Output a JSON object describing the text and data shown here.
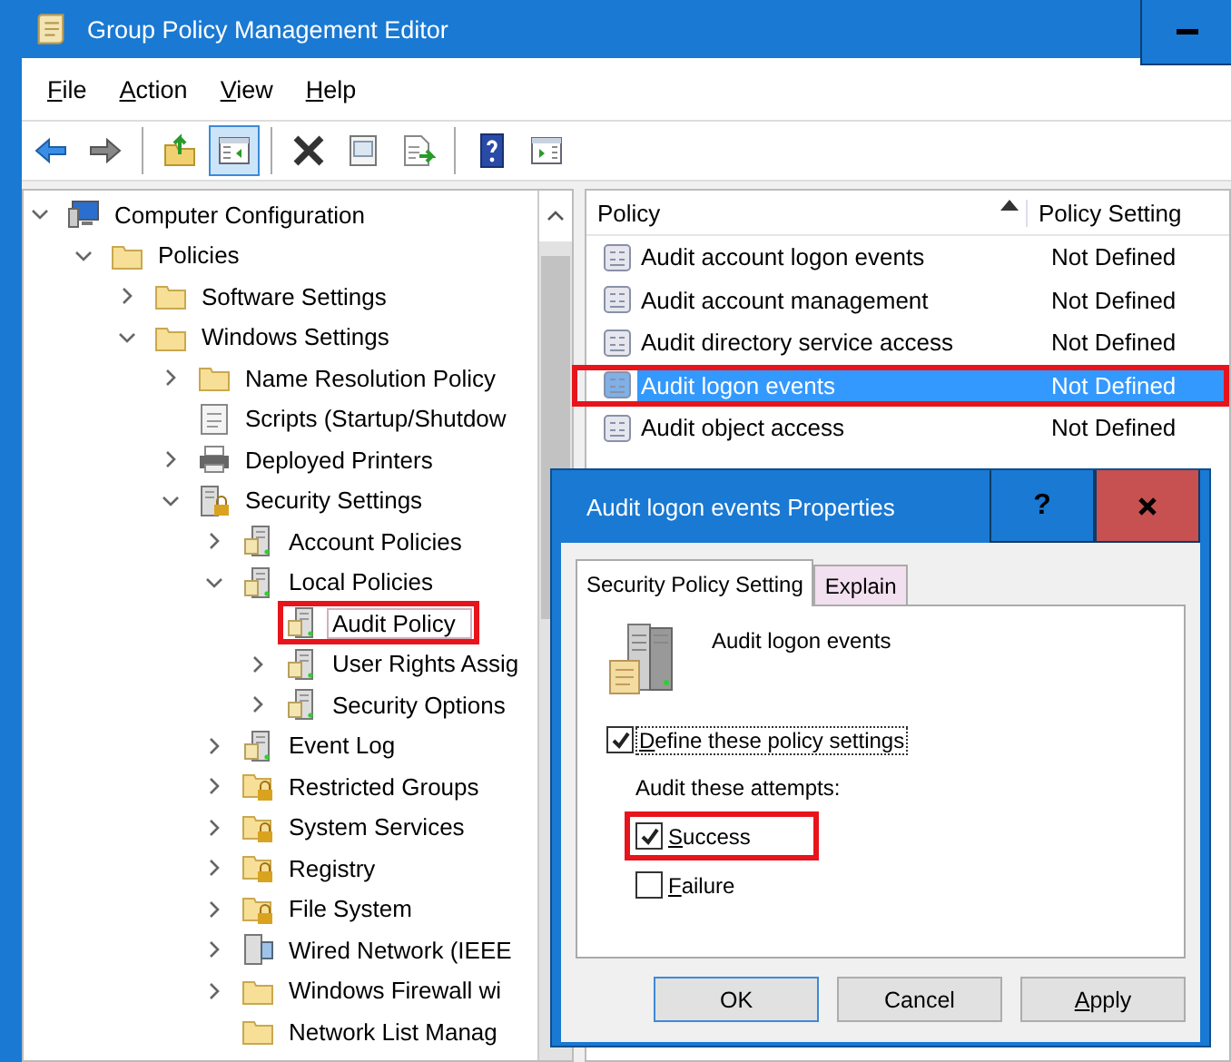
{
  "window": {
    "title": "Group Policy Management Editor"
  },
  "menu": [
    "File",
    "Action",
    "View",
    "Help"
  ],
  "toolbar": [
    {
      "kind": "back",
      "pressed": false
    },
    {
      "kind": "forward",
      "pressed": false
    },
    {
      "kind": "separator"
    },
    {
      "kind": "up-folder",
      "pressed": false
    },
    {
      "kind": "tree-pane",
      "pressed": true
    },
    {
      "kind": "separator"
    },
    {
      "kind": "delete",
      "pressed": false
    },
    {
      "kind": "properties",
      "pressed": false
    },
    {
      "kind": "export",
      "pressed": false
    },
    {
      "kind": "separator"
    },
    {
      "kind": "help",
      "pressed": false
    },
    {
      "kind": "action-pane",
      "pressed": false
    }
  ],
  "tree": [
    {
      "label": "Computer Configuration",
      "kind": "computer",
      "expanded": true,
      "selected": false,
      "highlighted": false,
      "children": [
        {
          "label": "Policies",
          "kind": "folder",
          "expanded": true,
          "selected": false,
          "highlighted": false,
          "children": [
            {
              "label": "Software Settings",
              "kind": "folder",
              "expanded": false,
              "selected": false,
              "highlighted": false
            },
            {
              "label": "Windows Settings",
              "kind": "folder",
              "expanded": true,
              "selected": false,
              "highlighted": false,
              "children": [
                {
                  "label": "Name Resolution Policy",
                  "kind": "folder",
                  "expanded": false,
                  "selected": false,
                  "highlighted": false
                },
                {
                  "label": "Scripts (Startup/Shutdow",
                  "kind": "script",
                  "selected": false,
                  "highlighted": false
                },
                {
                  "label": "Deployed Printers",
                  "kind": "printer",
                  "expanded": false,
                  "selected": false,
                  "highlighted": false
                },
                {
                  "label": "Security Settings",
                  "kind": "secure-server",
                  "expanded": true,
                  "selected": false,
                  "highlighted": false,
                  "children": [
                    {
                      "label": "Account Policies",
                      "kind": "server",
                      "expanded": false,
                      "selected": false,
                      "highlighted": false
                    },
                    {
                      "label": "Local Policies",
                      "kind": "server",
                      "expanded": true,
                      "selected": false,
                      "highlighted": false,
                      "children": [
                        {
                          "label": "Audit Policy",
                          "kind": "server",
                          "selected": true,
                          "highlighted": true
                        },
                        {
                          "label": "User Rights Assig",
                          "kind": "server",
                          "expanded": false,
                          "selected": false,
                          "highlighted": false
                        },
                        {
                          "label": "Security Options",
                          "kind": "server",
                          "expanded": false,
                          "selected": false,
                          "highlighted": false
                        }
                      ]
                    },
                    {
                      "label": "Event Log",
                      "kind": "server",
                      "expanded": false,
                      "selected": false,
                      "highlighted": false
                    },
                    {
                      "label": "Restricted Groups",
                      "kind": "secure-folder",
                      "expanded": false,
                      "selected": false,
                      "highlighted": false
                    },
                    {
                      "label": "System Services",
                      "kind": "secure-folder",
                      "expanded": false,
                      "selected": false,
                      "highlighted": false
                    },
                    {
                      "label": "Registry",
                      "kind": "secure-folder",
                      "expanded": false,
                      "selected": false,
                      "highlighted": false
                    },
                    {
                      "label": "File System",
                      "kind": "secure-folder",
                      "expanded": false,
                      "selected": false,
                      "highlighted": false
                    },
                    {
                      "label": "Wired Network (IEEE",
                      "kind": "network",
                      "expanded": false,
                      "selected": false,
                      "highlighted": false
                    },
                    {
                      "label": "Windows Firewall wi",
                      "kind": "folder",
                      "expanded": false,
                      "selected": false,
                      "highlighted": false
                    },
                    {
                      "label": "Network List Manag",
                      "kind": "folder",
                      "selected": false,
                      "highlighted": false
                    }
                  ]
                }
              ]
            }
          ]
        }
      ]
    }
  ],
  "table": {
    "columns": [
      "Policy",
      "Policy Setting"
    ],
    "rows": [
      {
        "policy": "Audit account logon events",
        "setting": "Not Defined",
        "selected": false,
        "highlighted": false
      },
      {
        "policy": "Audit account management",
        "setting": "Not Defined",
        "selected": false,
        "highlighted": false
      },
      {
        "policy": "Audit directory service access",
        "setting": "Not Defined",
        "selected": false,
        "highlighted": false
      },
      {
        "policy": "Audit logon events",
        "setting": "Not Defined",
        "selected": true,
        "highlighted": true
      },
      {
        "policy": "Audit object access",
        "setting": "Not Defined",
        "selected": false,
        "highlighted": false
      }
    ]
  },
  "dialog": {
    "title": "Audit logon events Properties",
    "help": "?",
    "tabs": [
      {
        "label": "Security Policy Setting",
        "selected": true
      },
      {
        "label": "Explain",
        "selected": false
      }
    ],
    "policy_name": "Audit logon events",
    "define": {
      "label": "Define these policy settings",
      "checked": true
    },
    "attempts_label": "Audit these attempts:",
    "attempts": [
      {
        "label": "Success",
        "checked": true,
        "highlighted": true
      },
      {
        "label": "Failure",
        "checked": false,
        "highlighted": false
      }
    ],
    "buttons": [
      "OK",
      "Cancel",
      "Apply"
    ]
  }
}
